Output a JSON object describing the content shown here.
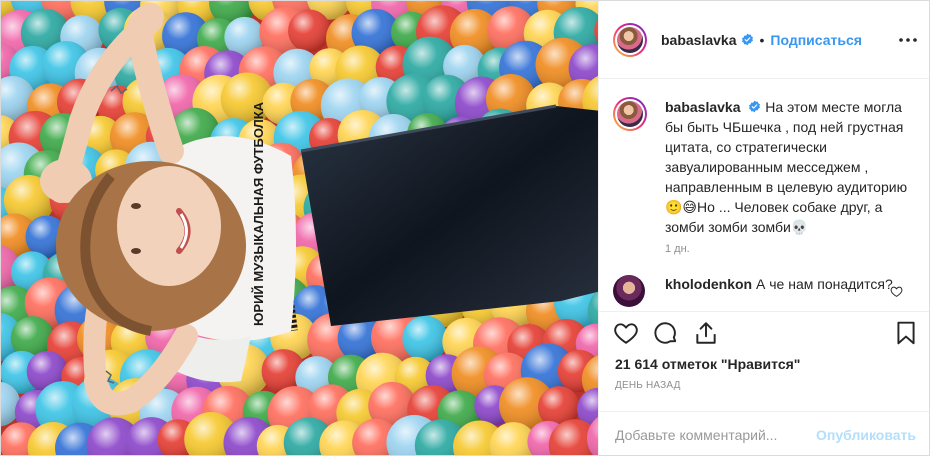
{
  "colors": {
    "accent": "#3897f0",
    "text": "#262626",
    "muted": "#8e8e8e",
    "publish_disabled": "#b2dffc",
    "photo_bg": "#c43a2e"
  },
  "header": {
    "username": "babaslavka",
    "verified": true,
    "follow_label": "Подписаться",
    "separator": "•",
    "more_icon": "more-horizontal-icon"
  },
  "photo": {
    "shirt_text": "ЮРИЙ МУЗЫКАЛЬНАЯ ФУТБОЛКА"
  },
  "caption": {
    "username": "babaslavka",
    "text": "На этом месте могла бы быть ЧБшечка , под ней грустная цитата, со стратегически завуалированным месседжем , направленным в целевую аудиторию 🙂😅Но ... Человек собаке друг, а зомби зомби зомби💀",
    "time": "1 дн."
  },
  "comments": [
    {
      "username": "kholodenkon",
      "text": "А че нам понадится?"
    }
  ],
  "actions": {
    "like_icon": "heart-icon",
    "comment_icon": "comment-icon",
    "share_icon": "share-icon",
    "save_icon": "bookmark-icon"
  },
  "likes_text": "21 614 отметок \"Нравится\"",
  "date_text": "ДЕНЬ НАЗАД",
  "add_comment": {
    "placeholder": "Добавьте комментарий...",
    "publish_label": "Опубликовать"
  }
}
